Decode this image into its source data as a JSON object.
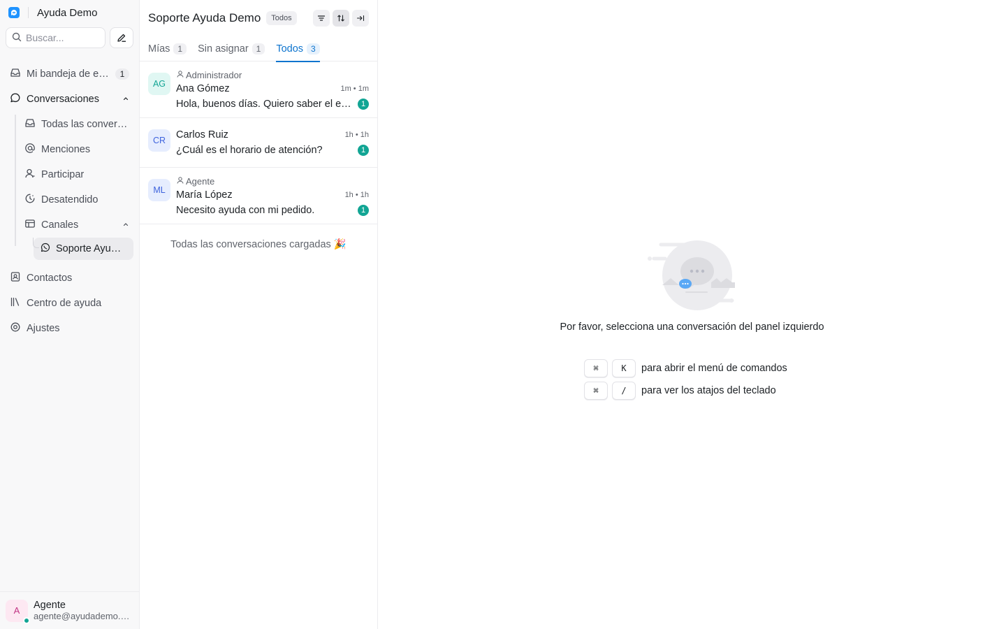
{
  "sidebar": {
    "brand_name": "Ayuda Demo",
    "search_placeholder": "Buscar...",
    "nav": {
      "inbox": {
        "label": "Mi bandeja de entrada",
        "count": "1"
      },
      "conversations": {
        "label": "Conversaciones"
      },
      "sub": {
        "all": "Todas las conversaciones",
        "mentions": "Menciones",
        "participating": "Participar",
        "unattended": "Desatendido",
        "channels": "Canales"
      },
      "channel": "Soporte Ayuda Demo",
      "contacts": "Contactos",
      "help_center": "Centro de ayuda",
      "settings": "Ajustes"
    },
    "user": {
      "initial": "A",
      "name": "Agente",
      "email": "agente@ayudademo.com"
    }
  },
  "conversations": {
    "title": "Soporte Ayuda Demo",
    "status_filter": "Todos",
    "tabs": [
      {
        "label": "Mías",
        "count": "1"
      },
      {
        "label": "Sin asignar",
        "count": "1"
      },
      {
        "label": "Todos",
        "count": "3"
      }
    ],
    "items": [
      {
        "initials": "AG",
        "assignee": "Administrador",
        "name": "Ana Gómez",
        "time": "1m • 1m",
        "message": "Hola, buenos días. Quiero saber el estado de mi reembolso.",
        "unread": "1"
      },
      {
        "initials": "CR",
        "assignee": "",
        "name": "Carlos Ruiz",
        "time": "1h • 1h",
        "message": "¿Cuál es el horario de atención?",
        "unread": "1"
      },
      {
        "initials": "ML",
        "assignee": "Agente",
        "name": "María López",
        "time": "1h • 1h",
        "message": "Necesito ayuda con mi pedido.",
        "unread": "1"
      }
    ],
    "loaded_note": "Todas las conversaciones cargadas 🎉"
  },
  "empty_state": {
    "message": "Por favor, selecciona una conversación del panel izquierdo",
    "shortcuts": [
      {
        "keys": [
          "⌘",
          "K"
        ],
        "text": "para abrir el menú de comandos"
      },
      {
        "keys": [
          "⌘",
          "/"
        ],
        "text": "para ver los atajos del teclado"
      }
    ]
  },
  "colors": {
    "accent": "#0d74ce",
    "unread": "#12a594",
    "brand": "#1f93ff"
  }
}
